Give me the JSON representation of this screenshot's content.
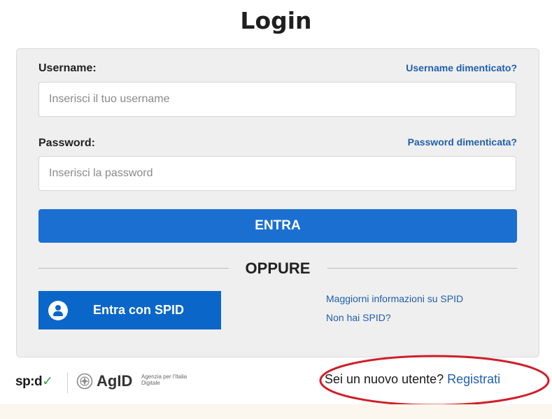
{
  "page": {
    "title": "Login"
  },
  "form": {
    "username": {
      "label": "Username:",
      "forgot_link": "Username dimenticato?",
      "placeholder": "Inserisci il tuo username",
      "value": ""
    },
    "password": {
      "label": "Password:",
      "forgot_link": "Password dimenticata?",
      "placeholder": "Inserisci la password",
      "value": ""
    },
    "submit_label": "ENTRA",
    "divider_label": "OPPURE"
  },
  "spid": {
    "button_label": "Entra con SPID",
    "icon": "user-circle-icon",
    "info_link": "Maggiorni informazioni su SPID",
    "no_spid_link": "Non hai SPID?"
  },
  "footer": {
    "spid_logo": "sp:d",
    "agid_logo": "AgID",
    "agid_subtitle": "Agenzia per l'Italia Digitale",
    "new_user_text": "Sei un nuovo utente?",
    "register_link": "Registrati"
  },
  "colors": {
    "primary_button": "#1b6fd1",
    "spid_button": "#0a66c9",
    "link": "#1f5fae",
    "annotation_circle": "#d01e2a"
  }
}
